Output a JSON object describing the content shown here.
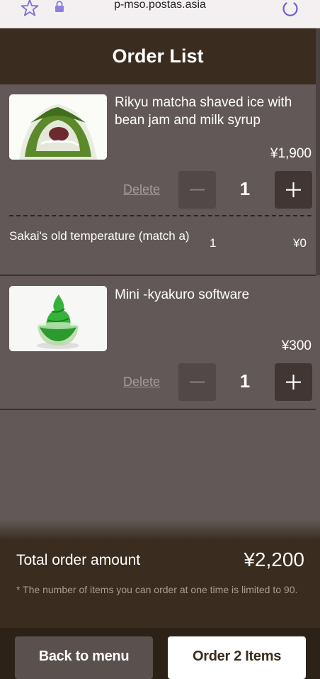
{
  "browser": {
    "url": "p-mso.postas.asia",
    "icons": [
      "star-icon",
      "lock-icon",
      "power-icon"
    ]
  },
  "header": {
    "title": "Order List"
  },
  "items": [
    {
      "name": "Rikyu matcha shaved ice with bean jam and milk syrup",
      "price": "¥1,900",
      "delete_label": "Delete",
      "quantity": "1",
      "options": [
        {
          "name": "Sakai's old temperature (match a)",
          "quantity": "1",
          "price": "¥0"
        }
      ]
    },
    {
      "name": "Mini -kyakuro software",
      "price": "¥300",
      "delete_label": "Delete",
      "quantity": "1"
    }
  ],
  "footer": {
    "total_label": "Total order amount",
    "total_value": "¥2,200",
    "note": "* The number of items you can order at one time is limited to 90.",
    "back_label": "Back to menu",
    "order_label": "Order 2 Items"
  },
  "colors": {
    "header_bg": "#3a2d1f",
    "content_bg": "#625857",
    "button_dark": "#413634"
  }
}
